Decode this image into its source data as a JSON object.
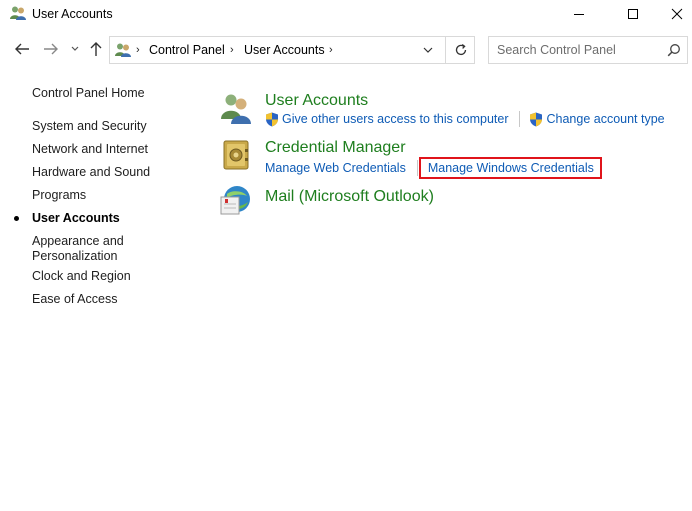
{
  "window": {
    "title": "User Accounts"
  },
  "address_bar": {
    "crumbs": [
      "Control Panel",
      "User Accounts"
    ]
  },
  "search": {
    "placeholder": "Search Control Panel"
  },
  "sidebar": {
    "items": [
      {
        "label": "Control Panel Home"
      },
      {
        "label": "System and Security"
      },
      {
        "label": "Network and Internet"
      },
      {
        "label": "Hardware and Sound"
      },
      {
        "label": "Programs"
      },
      {
        "label": "User Accounts",
        "active": true
      },
      {
        "label": "Appearance and Personalization"
      },
      {
        "label": "Clock and Region"
      },
      {
        "label": "Ease of Access"
      }
    ],
    "appearance_line1": "Appearance and",
    "appearance_line2": "Personalization"
  },
  "main": {
    "categories": [
      {
        "heading": "User Accounts",
        "icon": "users-icon",
        "links": [
          "Give other users access to this computer",
          "Change account type"
        ]
      },
      {
        "heading": "Credential Manager",
        "icon": "vault-icon",
        "links": [
          "Manage Web Credentials",
          "Manage Windows Credentials"
        ]
      },
      {
        "heading": "Mail (Microsoft Outlook)",
        "icon": "mail-icon",
        "links": []
      }
    ]
  },
  "colors": {
    "heading_green": "#1e7e1e",
    "link_blue": "#0e5bb5",
    "highlight_red": "#e0141b"
  }
}
